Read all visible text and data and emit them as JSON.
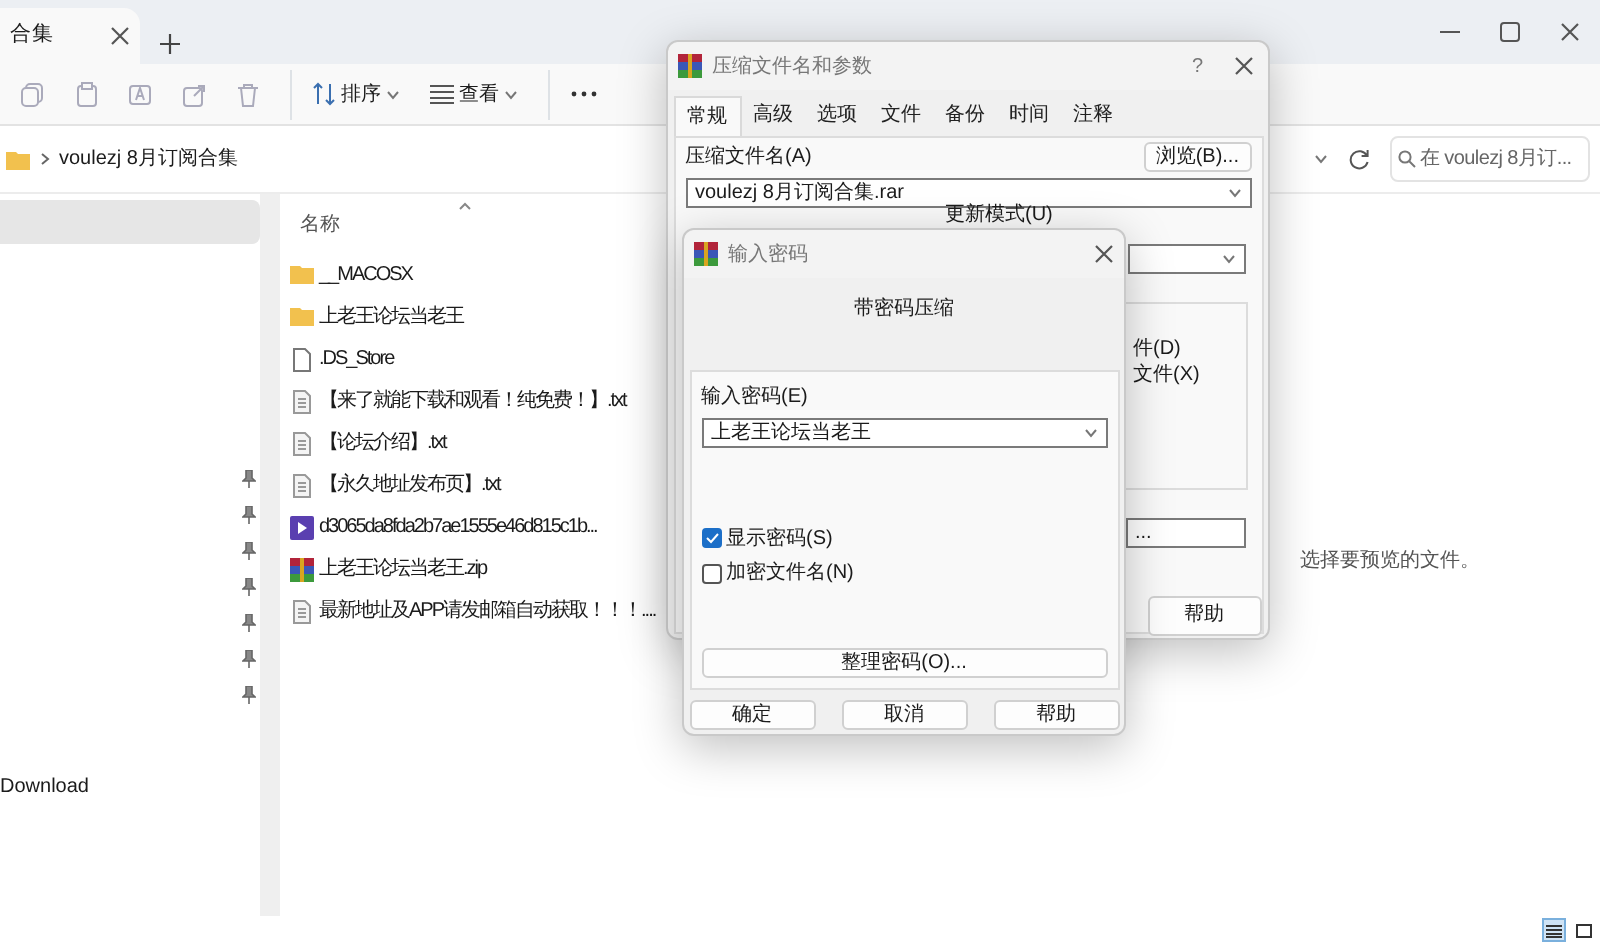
{
  "explorer": {
    "tab_title": "合集",
    "toolbar": {
      "sort_label": "排序",
      "view_label": "查看"
    },
    "address": {
      "path": "voulezj 8月订阅合集"
    },
    "search": {
      "placeholder": "在 voulezj 8月订..."
    },
    "sidebar": {
      "items": [
        {
          "label": "Download"
        }
      ]
    },
    "files": {
      "column": "名称",
      "items": [
        {
          "name": "__MACOSX",
          "kind": "folder"
        },
        {
          "name": "上老王论坛当老王",
          "kind": "folder"
        },
        {
          "name": ".DS_Store",
          "kind": "file"
        },
        {
          "name": "【来了就能下载和观看！纯免费！】.txt",
          "kind": "text"
        },
        {
          "name": "【论坛介绍】.txt",
          "kind": "text"
        },
        {
          "name": "【永久地址发布页】.txt",
          "kind": "text"
        },
        {
          "name": "d3065da8fda2b7ae1555e46d815c1b...",
          "kind": "video"
        },
        {
          "name": "上老王论坛当老王.zip",
          "kind": "archive"
        },
        {
          "name": "最新地址及APP请发邮箱自动获取！！！....",
          "kind": "text"
        }
      ]
    },
    "preview": "选择要预览的文件。",
    "view_modes": [
      {
        "selected": true
      },
      {
        "selected": false
      }
    ]
  },
  "archive_dialog": {
    "title": "压缩文件名和参数",
    "help_mark": "?",
    "tabs": [
      {
        "label": "常规",
        "selected": true
      },
      {
        "label": "高级",
        "selected": false
      },
      {
        "label": "选项",
        "selected": false
      },
      {
        "label": "文件",
        "selected": false
      },
      {
        "label": "备份",
        "selected": false
      },
      {
        "label": "时间",
        "selected": false
      },
      {
        "label": "注释",
        "selected": false
      }
    ],
    "archive_name_label": "压缩文件名(A)",
    "browse_button": "浏览(B)...",
    "archive_name": "voulezj 8月订阅合集.rar",
    "update_mode_label": "更新模式(U)",
    "option_fragments": [
      "件(D)",
      "文件(X)"
    ],
    "field_fragment": "...",
    "help_button": "帮助"
  },
  "password_dialog": {
    "title": "输入密码",
    "heading": "带密码压缩",
    "password_label": "输入密码(E)",
    "password": "上老王论坛当老王",
    "checkboxes": [
      {
        "label": "显示密码(S)",
        "checked": true
      },
      {
        "label": "加密文件名(N)",
        "checked": false
      }
    ],
    "organize_button": "整理密码(O)...",
    "buttons": [
      "确定",
      "取消",
      "帮助"
    ]
  }
}
